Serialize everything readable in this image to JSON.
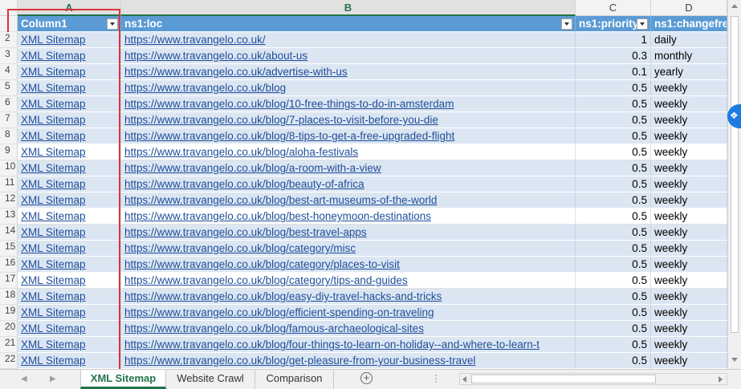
{
  "column_headers": [
    "A",
    "B",
    "C",
    "D"
  ],
  "table_headers": [
    "Column1",
    "ns1:loc",
    "ns1:priority",
    "ns1:changefre"
  ],
  "rows": [
    {
      "num": "2",
      "c1": "XML Sitemap",
      "loc": "https://www.travangelo.co.uk/",
      "priority": "1",
      "freq": "daily"
    },
    {
      "num": "3",
      "c1": "XML Sitemap",
      "loc": "https://www.travangelo.co.uk/about-us",
      "priority": "0.3",
      "freq": "monthly"
    },
    {
      "num": "4",
      "c1": "XML Sitemap",
      "loc": "https://www.travangelo.co.uk/advertise-with-us",
      "priority": "0.1",
      "freq": "yearly"
    },
    {
      "num": "5",
      "c1": "XML Sitemap",
      "loc": "https://www.travangelo.co.uk/blog",
      "priority": "0.5",
      "freq": "weekly"
    },
    {
      "num": "6",
      "c1": "XML Sitemap",
      "loc": "https://www.travangelo.co.uk/blog/10-free-things-to-do-in-amsterdam",
      "priority": "0.5",
      "freq": "weekly"
    },
    {
      "num": "7",
      "c1": "XML Sitemap",
      "loc": "https://www.travangelo.co.uk/blog/7-places-to-visit-before-you-die",
      "priority": "0.5",
      "freq": "weekly"
    },
    {
      "num": "8",
      "c1": "XML Sitemap",
      "loc": "https://www.travangelo.co.uk/blog/8-tips-to-get-a-free-upgraded-flight",
      "priority": "0.5",
      "freq": "weekly"
    },
    {
      "num": "9",
      "c1": "XML Sitemap",
      "loc": "https://www.travangelo.co.uk/blog/aloha-festivals",
      "priority": "0.5",
      "freq": "weekly"
    },
    {
      "num": "10",
      "c1": "XML Sitemap",
      "loc": "https://www.travangelo.co.uk/blog/a-room-with-a-view",
      "priority": "0.5",
      "freq": "weekly"
    },
    {
      "num": "11",
      "c1": "XML Sitemap",
      "loc": "https://www.travangelo.co.uk/blog/beauty-of-africa",
      "priority": "0.5",
      "freq": "weekly"
    },
    {
      "num": "12",
      "c1": "XML Sitemap",
      "loc": "https://www.travangelo.co.uk/blog/best-art-museums-of-the-world",
      "priority": "0.5",
      "freq": "weekly"
    },
    {
      "num": "13",
      "c1": "XML Sitemap",
      "loc": "https://www.travangelo.co.uk/blog/best-honeymoon-destinations",
      "priority": "0.5",
      "freq": "weekly"
    },
    {
      "num": "14",
      "c1": "XML Sitemap",
      "loc": "https://www.travangelo.co.uk/blog/best-travel-apps",
      "priority": "0.5",
      "freq": "weekly"
    },
    {
      "num": "15",
      "c1": "XML Sitemap",
      "loc": "https://www.travangelo.co.uk/blog/category/misc",
      "priority": "0.5",
      "freq": "weekly"
    },
    {
      "num": "16",
      "c1": "XML Sitemap",
      "loc": "https://www.travangelo.co.uk/blog/category/places-to-visit",
      "priority": "0.5",
      "freq": "weekly"
    },
    {
      "num": "17",
      "c1": "XML Sitemap",
      "loc": "https://www.travangelo.co.uk/blog/category/tips-and-guides",
      "priority": "0.5",
      "freq": "weekly"
    },
    {
      "num": "18",
      "c1": "XML Sitemap",
      "loc": "https://www.travangelo.co.uk/blog/easy-diy-travel-hacks-and-tricks",
      "priority": "0.5",
      "freq": "weekly"
    },
    {
      "num": "19",
      "c1": "XML Sitemap",
      "loc": "https://www.travangelo.co.uk/blog/efficient-spending-on-traveling",
      "priority": "0.5",
      "freq": "weekly"
    },
    {
      "num": "20",
      "c1": "XML Sitemap",
      "loc": "https://www.travangelo.co.uk/blog/famous-archaeological-sites",
      "priority": "0.5",
      "freq": "weekly"
    },
    {
      "num": "21",
      "c1": "XML Sitemap",
      "loc": "https://www.travangelo.co.uk/blog/four-things-to-learn-on-holiday--and-where-to-learn-t",
      "priority": "0.5",
      "freq": "weekly"
    },
    {
      "num": "22",
      "c1": "XML Sitemap",
      "loc": "https://www.travangelo.co.uk/blog/get-pleasure-from-your-business-travel",
      "priority": "0.5",
      "freq": "weekly"
    }
  ],
  "sheet_tabs": [
    "XML Sitemap",
    "Website Crawl",
    "Comparison"
  ],
  "add_sheet_label": "+",
  "tabbar_dots": "⋮",
  "colors": {
    "header_blue": "#5b9bd5",
    "band": "#dce6f2",
    "link": "#1f4e9a",
    "excel_green": "#217346",
    "highlight": "#d9343a"
  },
  "icons": {
    "filter": "filter-dropdown-icon",
    "add": "plus-circle-icon",
    "fab": "dropbox-icon"
  }
}
